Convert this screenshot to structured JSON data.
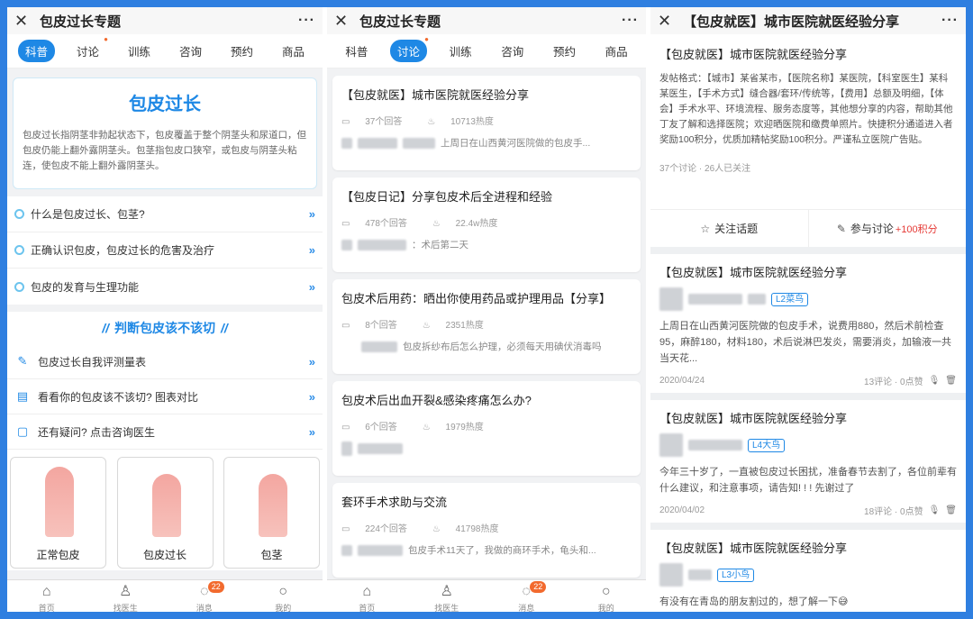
{
  "phone1": {
    "title": "包皮过长专题",
    "close_icon": "close-icon",
    "more": "···",
    "tabs": [
      "科普",
      "讨论",
      "训练",
      "咨询",
      "预约",
      "商品"
    ],
    "intro_title": "包皮过长",
    "intro_text": "包皮过长指阴茎非勃起状态下，包皮覆盖于整个阴茎头和尿道口，但包皮仍能上翻外露阴茎头。包茎指包皮口狭窄，或包皮与阴茎头粘连，使包皮不能上翻外露阴茎头。",
    "links": [
      "什么是包皮过长、包茎?",
      "正确认识包皮，包皮过长的危害及治疗",
      "包皮的发育与生理功能"
    ],
    "section_title": "判断包皮该不该切",
    "section_bars": "//",
    "tools": [
      "包皮过长自我评测量表",
      "看看你的包皮该不该切? 图表对比",
      "还有疑问? 点击咨询医生"
    ],
    "compare": [
      "正常包皮",
      "包皮过长",
      "包茎"
    ]
  },
  "phone2": {
    "title": "包皮过长专题",
    "posts": [
      {
        "title": "【包皮就医】城市医院就医经验分享",
        "replies": "37个回答",
        "heat": "10713热度",
        "snippet": "上周日在山西黄河医院做的包皮手..."
      },
      {
        "title": "【包皮日记】分享包皮术后全进程和经验",
        "replies": "478个回答",
        "heat": "22.4w热度",
        "snippet": "：术后第二天"
      },
      {
        "title": "包皮术后用药：晒出你使用药品或护理用品【分享】",
        "replies": "8个回答",
        "heat": "2351热度",
        "snippet": "包皮拆纱布后怎么护理，必须每天用碘伏消毒吗"
      },
      {
        "title": "包皮术后出血开裂&感染疼痛怎么办?",
        "replies": "6个回答",
        "heat": "1979热度",
        "snippet": ""
      },
      {
        "title": "套环手术求助与交流",
        "replies": "224个回答",
        "heat": "41798热度",
        "snippet": "包皮手术11天了，我做的商环手术，龟头和..."
      }
    ]
  },
  "phone3": {
    "title": "【包皮就医】城市医院就医经验分享",
    "heading": "【包皮就医】城市医院就医经验分享",
    "rules": "发帖格式：【城市】某省某市，【医院名称】某医院，【科室医生】某科某医生，【手术方式】缝合器/套环/传统等，【费用】总额及明细，【体会】手术水平、环境流程、服务态度等，其他想分享的内容，帮助其他丁友了解和选择医院；欢迎晒医院和缴费单照片。快捷积分通道进入者奖励100积分，优质加精帖奖励100积分。严谨私立医院广告贴。",
    "stats": "37个讨论 · 26人已关注",
    "follow": "关注话题",
    "join": "参与讨论",
    "join_points": "+100积分",
    "threads": [
      {
        "title": "【包皮就医】城市医院就医经验分享",
        "level": "L2菜鸟",
        "body": "上周日在山西黄河医院做的包皮手术，说费用880，然后术前检查95，麻醉180，材料180，术后说淋巴发炎，需要消炎，加输液一共当天花...",
        "date": "2020/04/24",
        "counts": "13评论 · 0点赞"
      },
      {
        "title": "【包皮就医】城市医院就医经验分享",
        "level": "L4大鸟",
        "body": "今年三十岁了，一直被包皮过长困扰，准备春节去割了，各位前辈有什么建议，和注意事项，请告知! ! ! 先谢过了",
        "date": "2020/04/02",
        "counts": "18评论 · 0点赞"
      },
      {
        "title": "【包皮就医】城市医院就医经验分享",
        "level": "L3小鸟",
        "body": "有没有在青岛的朋友割过的，想了解一下😅",
        "date": "",
        "counts": ""
      }
    ]
  },
  "nav": {
    "items": [
      "首页",
      "找医生",
      "消息",
      "我的"
    ],
    "badge": "22"
  }
}
